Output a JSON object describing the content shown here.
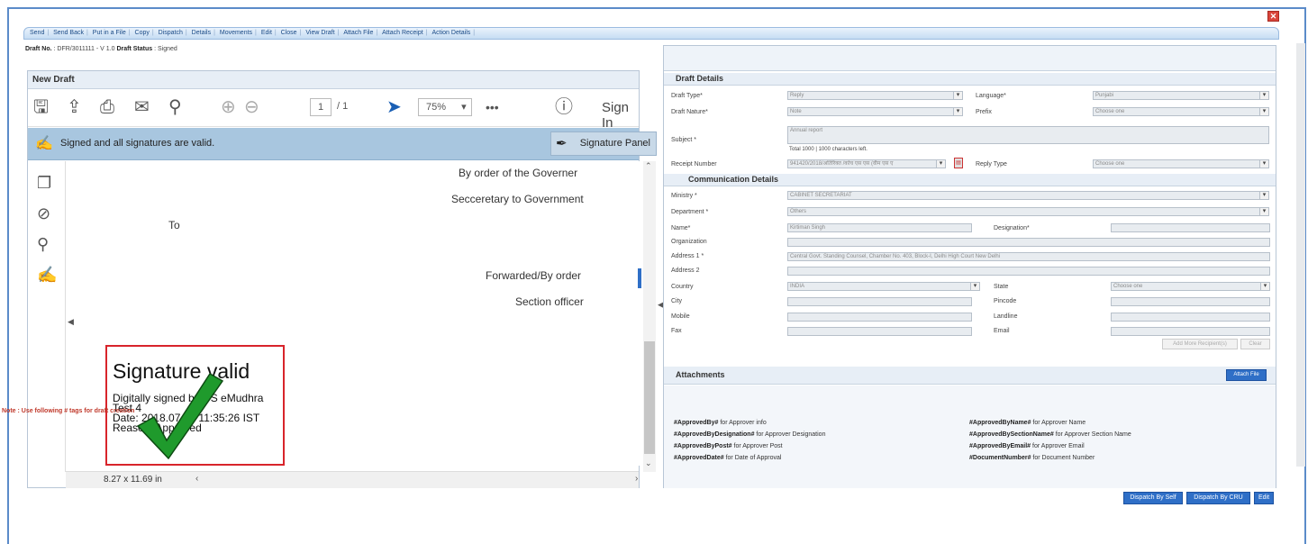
{
  "toolbar": {
    "items": [
      "Send",
      "Send Back",
      "Put in a File",
      "Copy",
      "Dispatch",
      "Details",
      "Movements",
      "Edit",
      "Close",
      "View Draft",
      "Attach File",
      "Attach Receipt",
      "Action Details"
    ]
  },
  "draft_info": {
    "no_label": "Draft No.",
    "no_value": ": DFR/3011111 - V 1.0",
    "status_label": "Draft Status",
    "status_value": ": Signed"
  },
  "left": {
    "title": "New Draft",
    "page_current": "1",
    "page_total": "/ 1",
    "zoom": "75%",
    "sign_in": "Sign In",
    "sig_status": "Signed and all signatures are valid.",
    "sig_panel": "Signature Panel",
    "doc_lines": [
      "By order of the Governer",
      "Secceretary to Government",
      "To",
      "Forwarded/By order",
      "Section officer"
    ],
    "stamp_title": "Signature valid",
    "stamp_lines": [
      "Digitally signed by DS eMudhra",
      "Test 4",
      "Date: 2018.07.26 11:35:26 IST",
      "Reason: Approved"
    ],
    "page_size": "8.27 x 11.69 in"
  },
  "right": {
    "draft_details_title": "Draft Details",
    "draft_type_label": "Draft Type*",
    "draft_type_value": "Reply",
    "language_label": "Language*",
    "language_value": "Punjabi",
    "draft_nature_label": "Draft Nature*",
    "draft_nature_value": "Note",
    "prefix_label": "Prefix",
    "prefix_value": "Choose one",
    "subject_label": "Subject *",
    "subject_value": "Annual report",
    "subject_counter": "Total 1000 | 1000 characters left.",
    "receipt_label": "Receipt Number",
    "receipt_value": "941420/2018/अतिरिक्त /कोच एस एस (वीम एस ए",
    "reply_type_label": "Reply Type",
    "reply_type_value": "Choose one",
    "comm_title": "Communication Details",
    "ministry_label": "Ministry *",
    "ministry_value": "CABINET SECRETARIAT",
    "department_label": "Department *",
    "department_value": "Others",
    "name_label": "Name*",
    "name_value": "Kirtiman Singh",
    "designation_label": "Designation*",
    "designation_value": "",
    "org_label": "Organization",
    "org_value": "",
    "addr1_label": "Address 1 *",
    "addr1_value": "Central Govt. Standing Counsel, Chamber No. 403, Block-I, Delhi High Court New Delhi",
    "addr2_label": "Address 2",
    "addr2_value": "",
    "country_label": "Country",
    "country_value": "INDIA",
    "state_label": "State",
    "state_value": "Choose one",
    "city_label": "City",
    "pincode_label": "Pincode",
    "mobile_label": "Mobile",
    "landline_label": "Landline",
    "fax_label": "Fax",
    "email_label": "Email",
    "add_more": "Add More Recipient(s)",
    "clear": "Clear",
    "attachments_title": "Attachments",
    "attach_file": "Attach File",
    "note": "Note : Use following # tags for draft creation",
    "tags_left": [
      [
        "#ApprovedBy#",
        "for Approver info"
      ],
      [
        "#ApprovedByDesignation#",
        "for Approver Designation"
      ],
      [
        "#ApprovedByPost#",
        "for Approver Post"
      ],
      [
        "#ApprovedDate#",
        "for Date of Approval"
      ]
    ],
    "tags_right": [
      [
        "#ApprovedByName#",
        "for Approver Name"
      ],
      [
        "#ApprovedBySectionName#",
        "for Approver Section Name"
      ],
      [
        "#ApprovedByEmail#",
        "for Approver Email"
      ],
      [
        "#DocumentNumber#",
        "for Document Number"
      ]
    ]
  },
  "bottom": {
    "dispatch_self": "Dispatch By Self",
    "dispatch_cru": "Dispatch By CRU",
    "edit": "Edit"
  }
}
